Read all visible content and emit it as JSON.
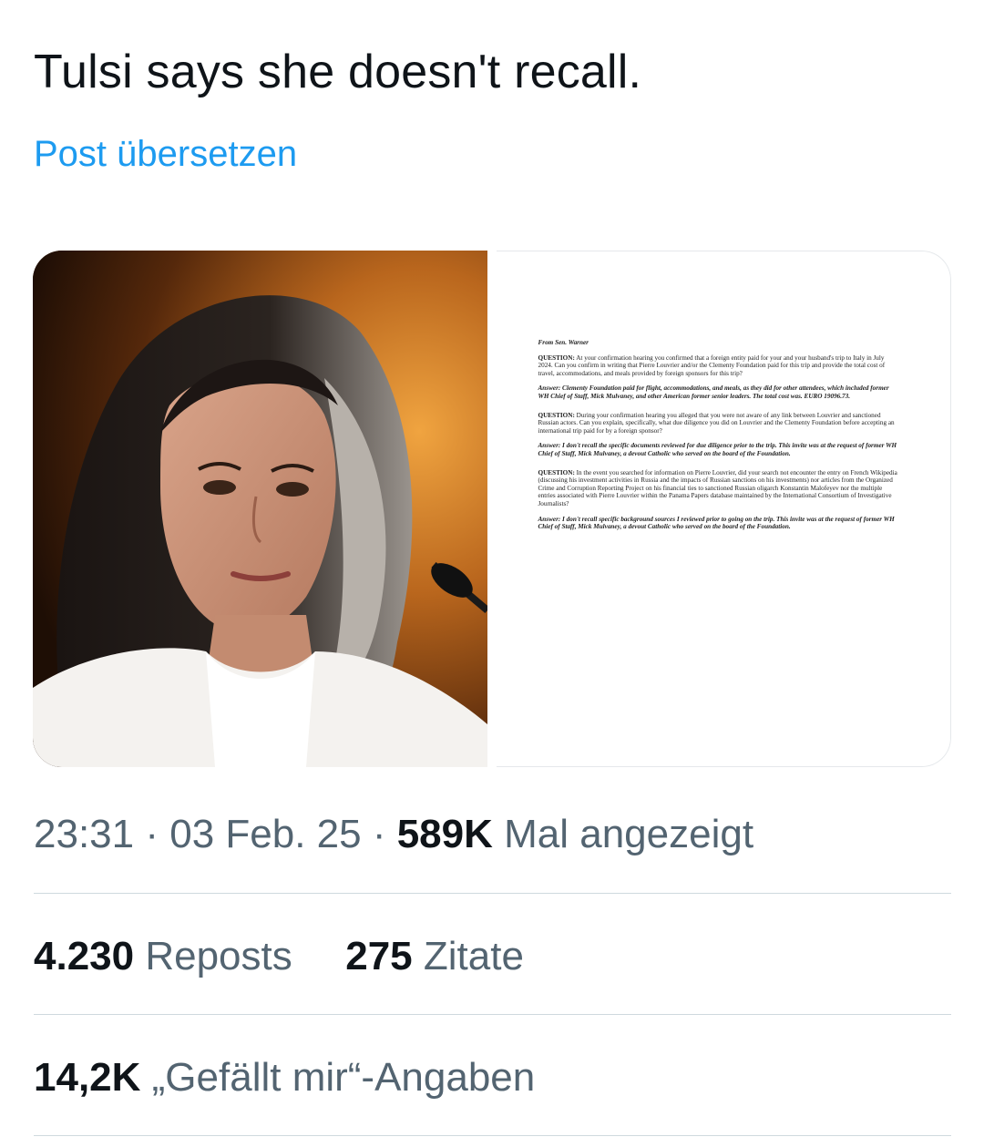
{
  "post": {
    "text": "Tulsi says she doesn't recall.",
    "translate_label": "Post übersetzen"
  },
  "media": {
    "photo_label": "Portrait photo at hearing",
    "document": {
      "from": "From Sen. Warner",
      "items": [
        {
          "q_label": "QUESTION:",
          "q_text": " At your confirmation hearing you confirmed that a foreign entity paid for your and your husband's trip to Italy in July 2024. Can you confirm in writing that Pierre Louvrier and/or the Clementy Foundation paid for this trip and provide the total cost of travel, accommodations, and meals provided by foreign sponsors for this trip?",
          "answer": "Answer: Clementy Foundation paid for flight, accommodations, and meals, as they did for other attendees, which included former WH Chief of Staff, Mick Mulvaney, and other American former senior leaders. The total cost was. EURO 19096.73."
        },
        {
          "q_label": "QUESTION:",
          "q_text": " During your confirmation hearing you alleged that you were not aware of any link between Louvrier and sanctioned Russian actors. Can you explain, specifically, what due diligence you did on Louvrier and the Clementy Foundation before accepting an international trip paid for by a foreign sponsor?",
          "answer": "Answer: I don't recall the specific documents reviewed for due diligence prior to the trip. This invite was at the request of former WH Chief of Staff, Mick Mulvaney, a devout Catholic who served on the board of the Foundation."
        },
        {
          "q_label": "QUESTION:",
          "q_text": " In the event you searched for information on Pierre Louvrier, did your search not encounter the entry on French Wikipedia (discussing his investment activities in Russia and the impacts of Russian sanctions on his investments) nor articles from the Organized Crime and Corruption Reporting Project on his financial ties to sanctioned Russian oligarch Konstantin Malofeyev nor the multiple entries associated with Pierre Louvrier within the Panama Papers database maintained by the International Consortium of Investigative Journalists?",
          "answer": "Answer: I don't recall specific background sources I reviewed prior to going on the trip. This invite was at the request of former WH Chief of Staff, Mick Mulvaney, a devout Catholic who served on the board of the Foundation."
        }
      ]
    }
  },
  "meta": {
    "time": "23:31",
    "sep1": " · ",
    "date": "03 Feb. 25",
    "sep2": " · ",
    "views": "589K",
    "views_label": " Mal angezeigt"
  },
  "stats": {
    "reposts_count": "4.230",
    "reposts_label": " Reposts",
    "quotes_count": "275",
    "quotes_label": " Zitate",
    "likes_count": "14,2K",
    "likes_label": " „Gefällt mir“-Angaben"
  },
  "colors": {
    "link": "#1d9bf0",
    "secondary_text": "#536471",
    "primary_text": "#0f1419",
    "divider": "#cfd9de"
  }
}
